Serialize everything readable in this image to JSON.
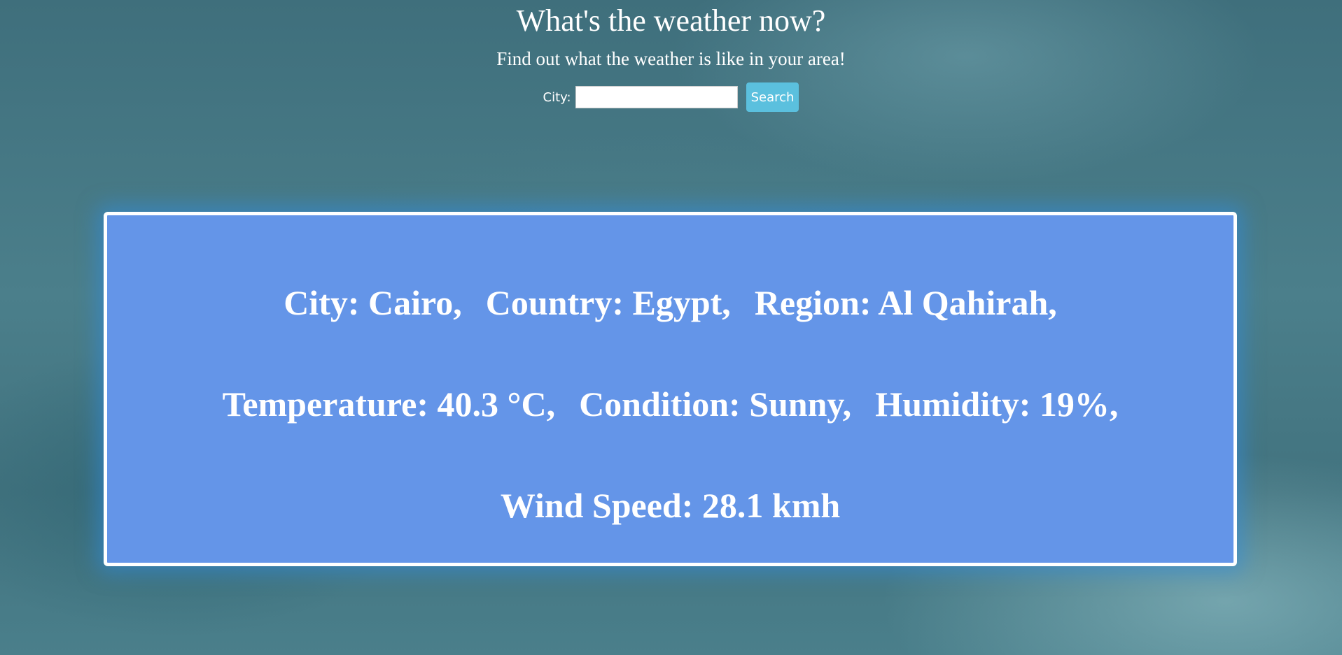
{
  "header": {
    "title": "What's the weather now?",
    "subtitle": "Find out what the weather is like in your area!"
  },
  "search": {
    "label": "City:",
    "value": "",
    "placeholder": "",
    "button_label": "Search"
  },
  "result": {
    "city": "City: Cairo,",
    "country": "Country: Egypt,",
    "region": "Region: Al Qahirah,",
    "temperature": "Temperature: 40.3 °C,",
    "condition": "Condition: Sunny,",
    "humidity": "Humidity: 19%,",
    "wind_speed": "Wind Speed: 28.1 kmh"
  },
  "colors": {
    "card_background": "#6495e8",
    "card_border": "#ffffff",
    "button_background": "#5bc0de",
    "text": "#ffffff"
  }
}
